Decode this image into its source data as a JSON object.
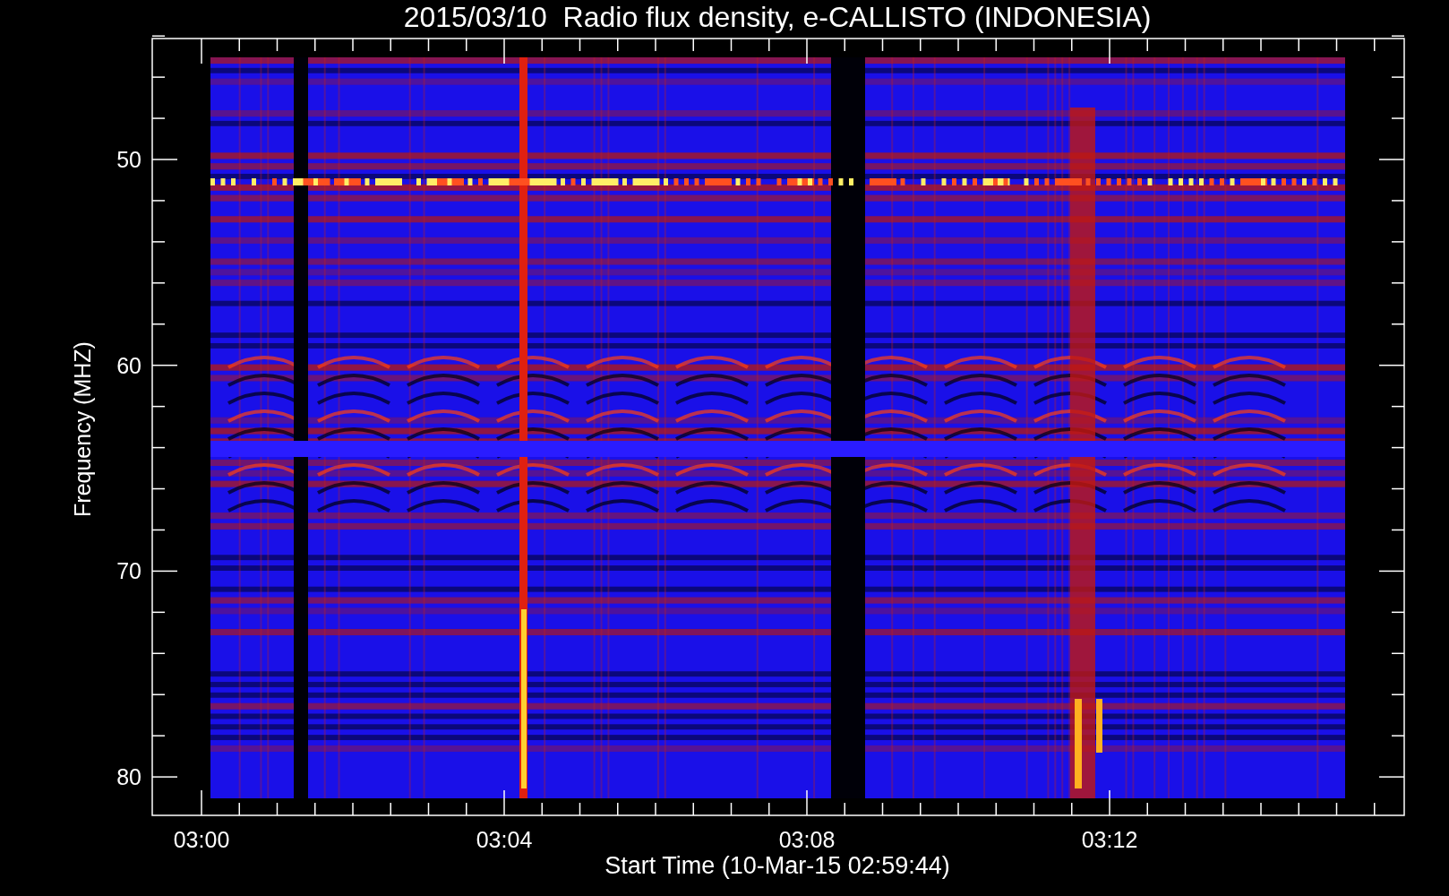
{
  "title": "2015/03/10  Radio flux density, e-CALLISTO (INDONESIA)",
  "y_axis": {
    "label": "Frequency (MHZ)",
    "ticks": [
      "50",
      "60",
      "70",
      "80"
    ]
  },
  "x_axis": {
    "label": "Start Time (10-Mar-15 02:59:44)",
    "ticks": [
      "03:00",
      "03:04",
      "03:08",
      "03:12"
    ]
  }
}
